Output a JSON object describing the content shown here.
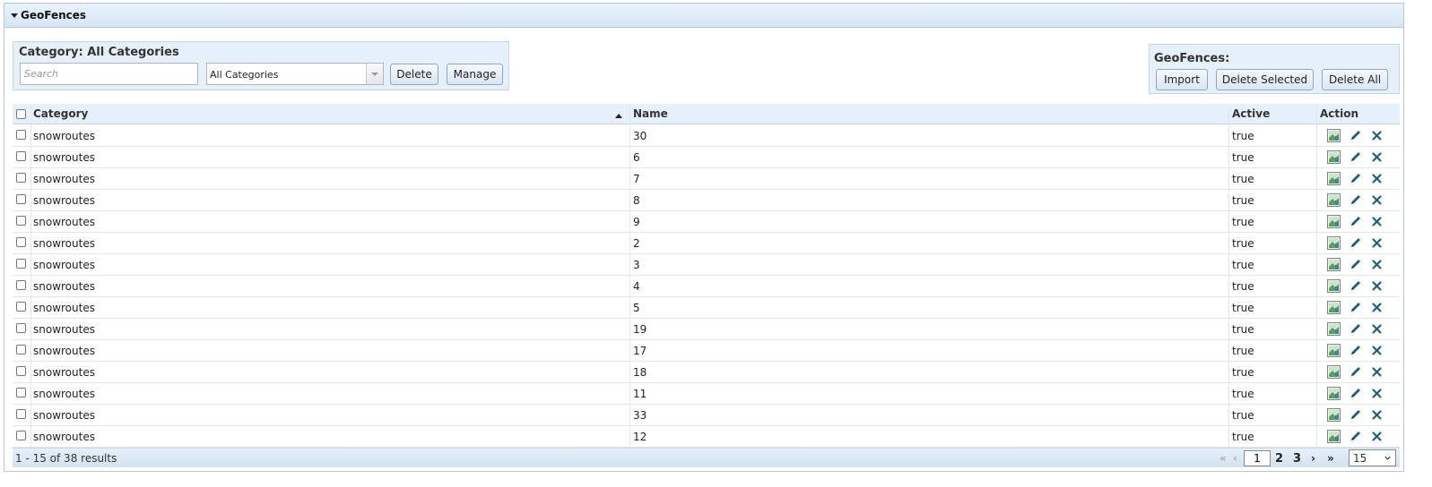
{
  "panel": {
    "title": "GeoFences"
  },
  "filter": {
    "title": "Category: All Categories",
    "search_placeholder": "Search",
    "category_selected": "All Categories",
    "delete_label": "Delete",
    "manage_label": "Manage"
  },
  "geofences_box": {
    "title": "GeoFences:",
    "import_label": "Import",
    "delete_selected_label": "Delete Selected",
    "delete_all_label": "Delete All"
  },
  "table": {
    "columns": {
      "category": "Category",
      "name": "Name",
      "active": "Active",
      "action": "Action"
    },
    "sort": {
      "column": "Category",
      "direction": "ascending"
    },
    "rows": [
      {
        "category": "snowroutes",
        "name": "30",
        "active": "true"
      },
      {
        "category": "snowroutes",
        "name": "6",
        "active": "true"
      },
      {
        "category": "snowroutes",
        "name": "7",
        "active": "true"
      },
      {
        "category": "snowroutes",
        "name": "8",
        "active": "true"
      },
      {
        "category": "snowroutes",
        "name": "9",
        "active": "true"
      },
      {
        "category": "snowroutes",
        "name": "2",
        "active": "true"
      },
      {
        "category": "snowroutes",
        "name": "3",
        "active": "true"
      },
      {
        "category": "snowroutes",
        "name": "4",
        "active": "true"
      },
      {
        "category": "snowroutes",
        "name": "5",
        "active": "true"
      },
      {
        "category": "snowroutes",
        "name": "19",
        "active": "true"
      },
      {
        "category": "snowroutes",
        "name": "17",
        "active": "true"
      },
      {
        "category": "snowroutes",
        "name": "18",
        "active": "true"
      },
      {
        "category": "snowroutes",
        "name": "11",
        "active": "true"
      },
      {
        "category": "snowroutes",
        "name": "33",
        "active": "true"
      },
      {
        "category": "snowroutes",
        "name": "12",
        "active": "true"
      }
    ],
    "action_icons": [
      "map-icon",
      "edit-pencil-icon",
      "delete-x-icon"
    ]
  },
  "footer": {
    "results_text": "1 - 15 of 38 results",
    "first_glyph": "«",
    "prev_glyph": "‹",
    "current_page": "1",
    "pages": [
      "2",
      "3"
    ],
    "next_glyph": "›",
    "last_glyph": "»",
    "per_page": "15"
  },
  "colors": {
    "header_bg": "#d6e6f6",
    "box_bg": "#e6f0fa",
    "icon_teal": "#1f5f7a",
    "map_green": "#5aa05a"
  }
}
